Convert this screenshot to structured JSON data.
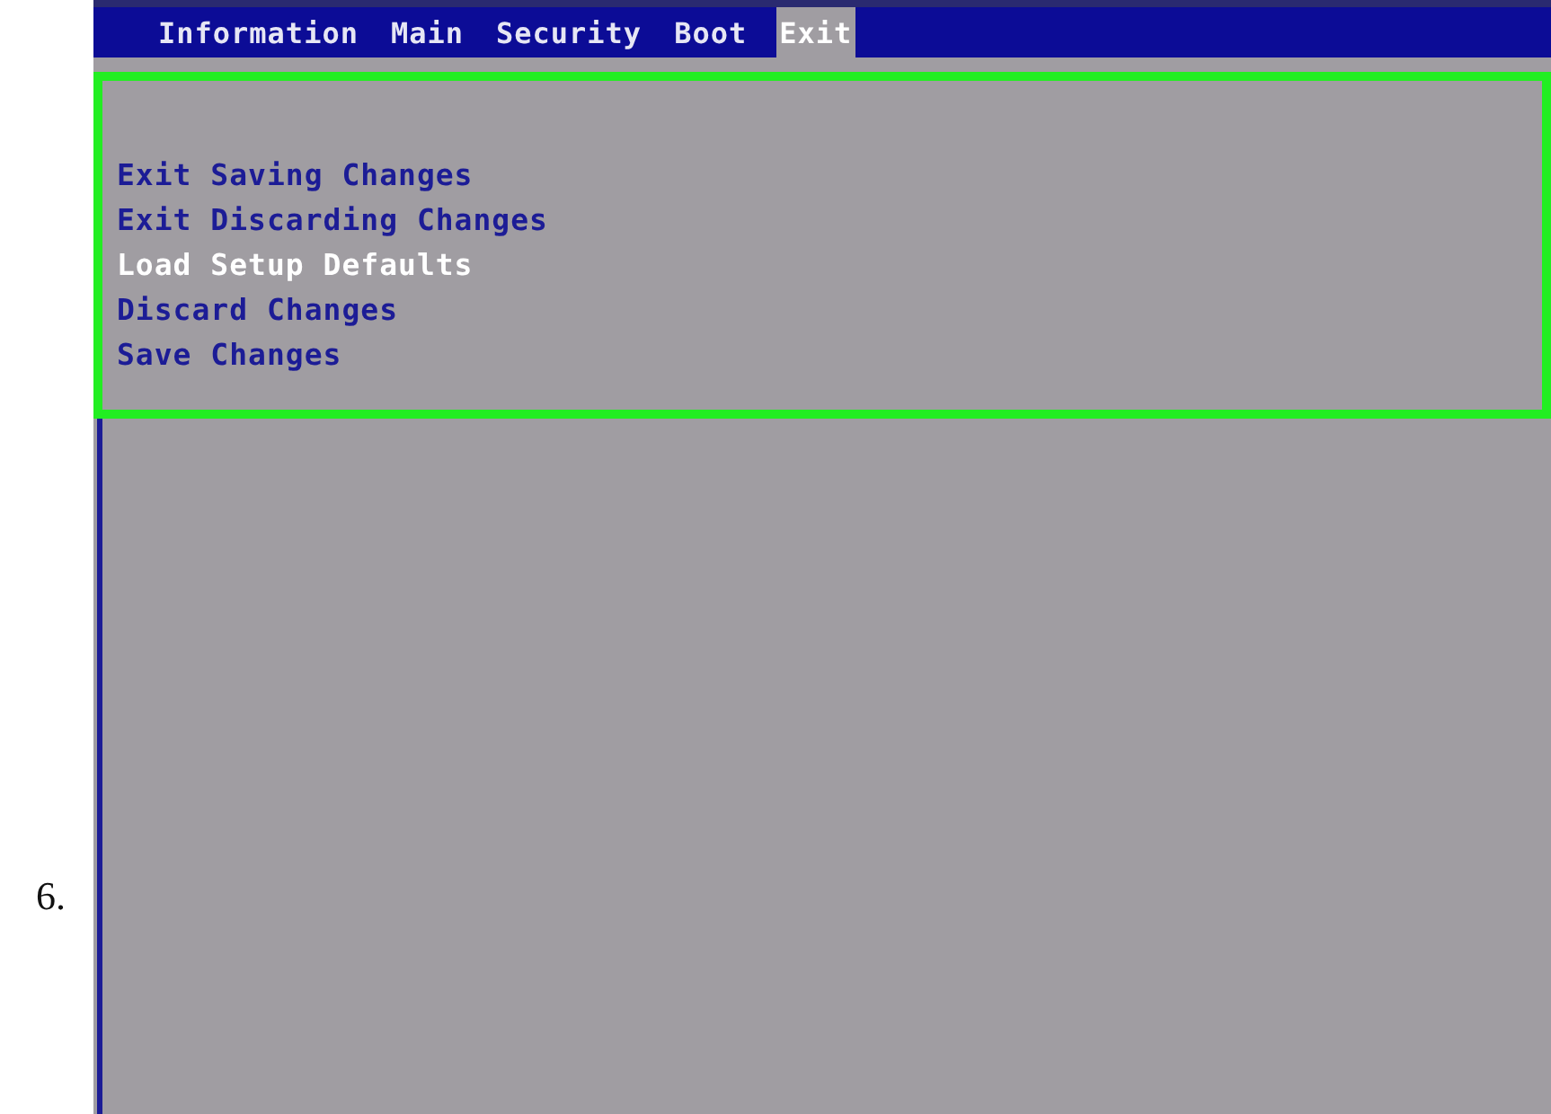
{
  "step_number": "6.",
  "tabs": [
    {
      "label": "Information",
      "selected": false
    },
    {
      "label": "Main",
      "selected": false
    },
    {
      "label": "Security",
      "selected": false
    },
    {
      "label": "Boot",
      "selected": false
    },
    {
      "label": "Exit",
      "selected": true
    }
  ],
  "menu_items": [
    {
      "label": "Exit Saving Changes",
      "selected": false
    },
    {
      "label": "Exit Discarding Changes",
      "selected": false
    },
    {
      "label": "Load Setup Defaults",
      "selected": true
    },
    {
      "label": "Discard Changes",
      "selected": false
    },
    {
      "label": "Save Changes",
      "selected": false
    }
  ]
}
